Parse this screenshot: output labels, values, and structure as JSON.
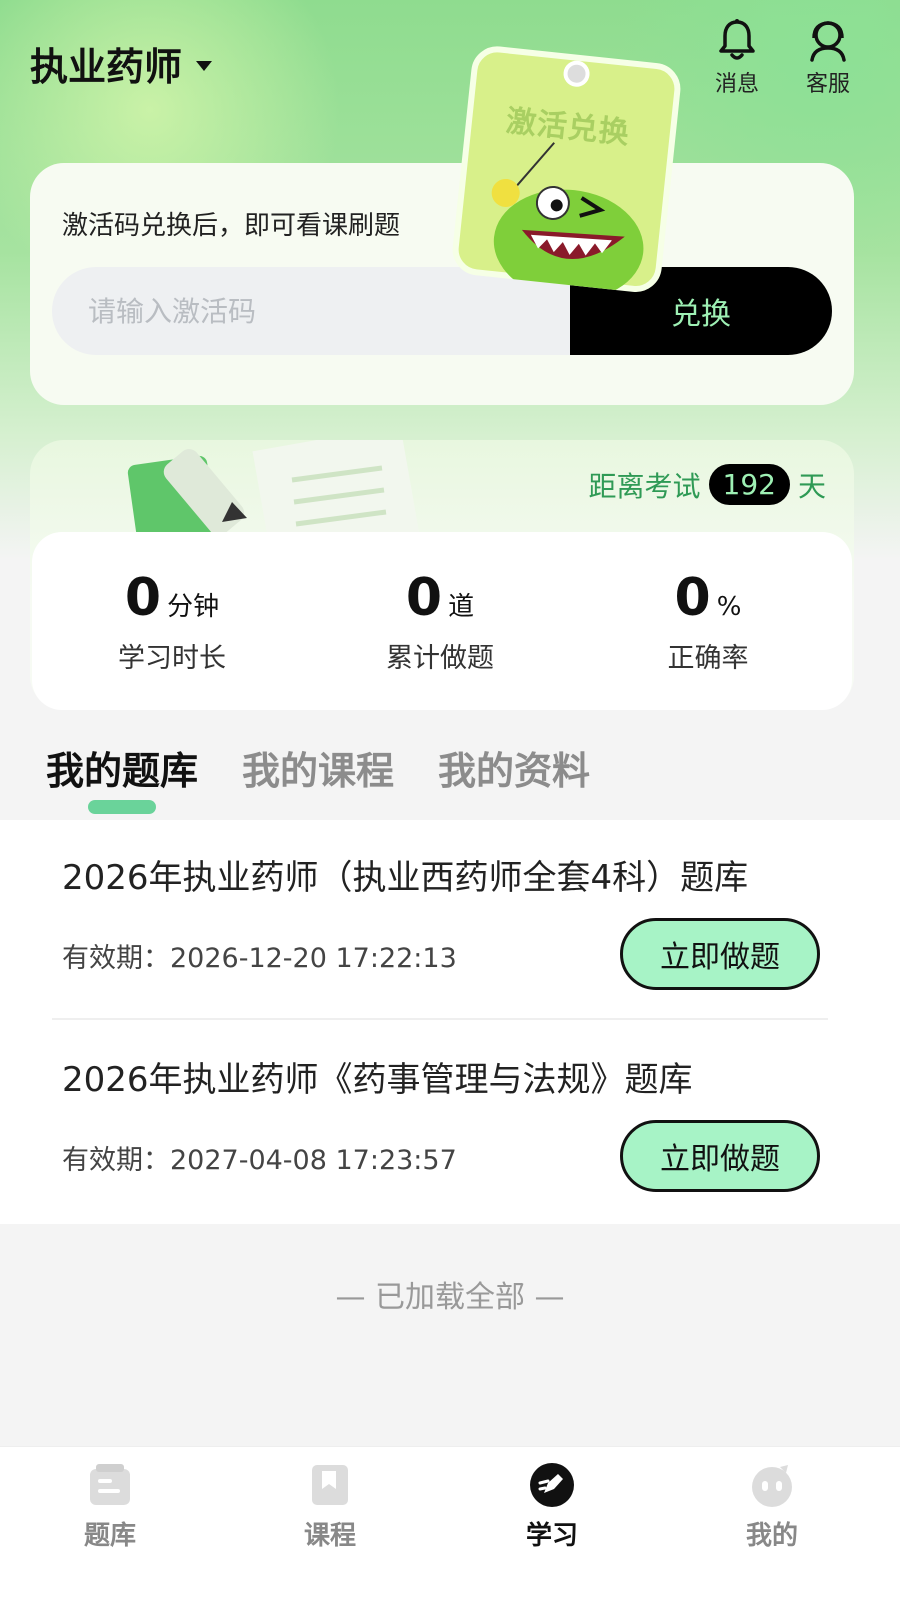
{
  "header": {
    "title": "执业药师",
    "actions": [
      {
        "label": "消息",
        "icon": "bell-icon"
      },
      {
        "label": "客服",
        "icon": "headset-icon"
      }
    ]
  },
  "mascot": {
    "tag_text": "激活兑换"
  },
  "redeem": {
    "tip": "激活码兑换后，即可看课刷题",
    "placeholder": "请输入激活码",
    "button": "兑换"
  },
  "countdown": {
    "prefix": "距离考试",
    "days": "192",
    "suffix": "天"
  },
  "stats": [
    {
      "value": "0",
      "unit": "分钟",
      "label": "学习时长"
    },
    {
      "value": "0",
      "unit": "道",
      "label": "累计做题"
    },
    {
      "value": "0",
      "unit": "%",
      "label": "正确率"
    }
  ],
  "tabs": [
    {
      "label": "我的题库",
      "active": true
    },
    {
      "label": "我的课程",
      "active": false
    },
    {
      "label": "我的资料",
      "active": false
    }
  ],
  "items": [
    {
      "title": "2026年执业药师（执业西药师全套4科）题库",
      "expiry": "有效期：2026-12-20 17:22:13",
      "button": "立即做题"
    },
    {
      "title": "2026年执业药师《药事管理与法规》题库",
      "expiry": "有效期：2027-04-08 17:23:57",
      "button": "立即做题"
    }
  ],
  "footer_note": "— 已加载全部 —",
  "bottom_nav": [
    {
      "label": "题库",
      "icon": "question-bank-icon",
      "active": false
    },
    {
      "label": "课程",
      "icon": "bookmark-icon",
      "active": false
    },
    {
      "label": "学习",
      "icon": "pen-study-icon",
      "active": true
    },
    {
      "label": "我的",
      "icon": "profile-face-icon",
      "active": false
    }
  ],
  "colors": {
    "accent_green": "#2f9a55",
    "button_green": "#a7f3c6",
    "dark": "#000000",
    "mint_text": "#9ef0b4"
  }
}
